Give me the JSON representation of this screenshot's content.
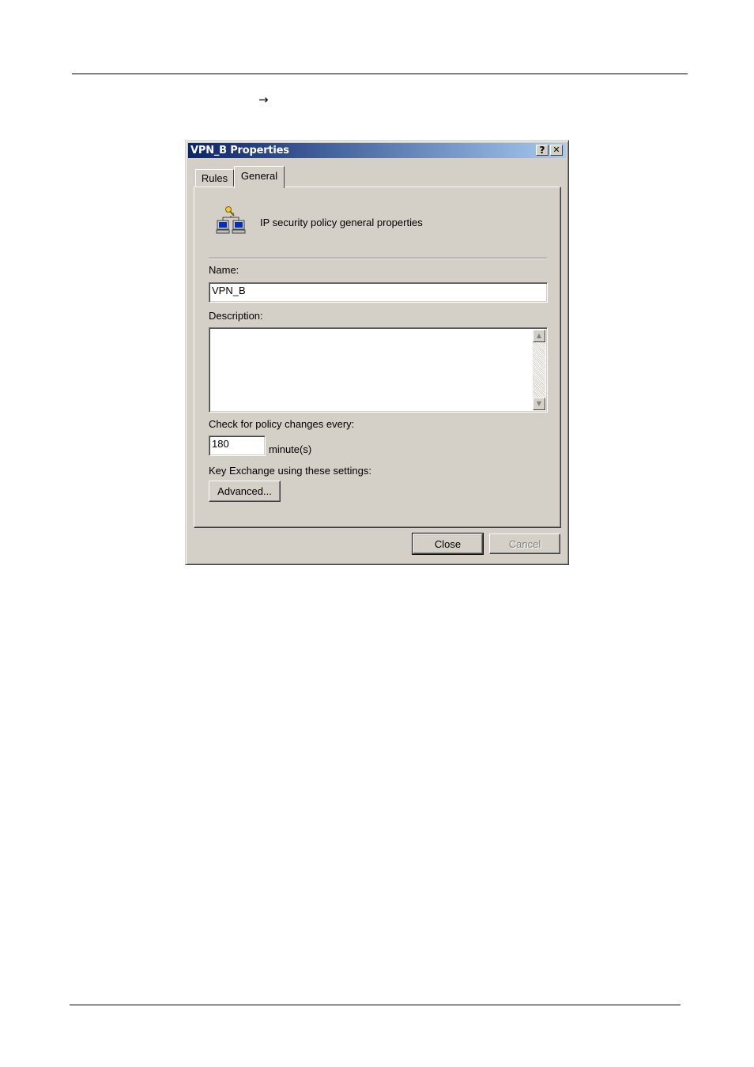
{
  "page": {
    "arrow_glyph": "→"
  },
  "dialog": {
    "title": "VPN_B Properties",
    "help_button": "?",
    "close_button": "✕",
    "tabs": [
      {
        "label": "Rules",
        "active": false
      },
      {
        "label": "General",
        "active": true
      }
    ],
    "header_text": "IP security policy general properties",
    "header_icon": "network-key-icon",
    "name_label": "Name:",
    "name_value": "VPN_B",
    "description_label": "Description:",
    "description_value": "",
    "check_label": "Check for policy changes every:",
    "check_value": "180",
    "check_unit": "minute(s)",
    "key_exchange_label": "Key Exchange using these settings:",
    "advanced_button": "Advanced...",
    "close_label": "Close",
    "cancel_label": "Cancel"
  }
}
